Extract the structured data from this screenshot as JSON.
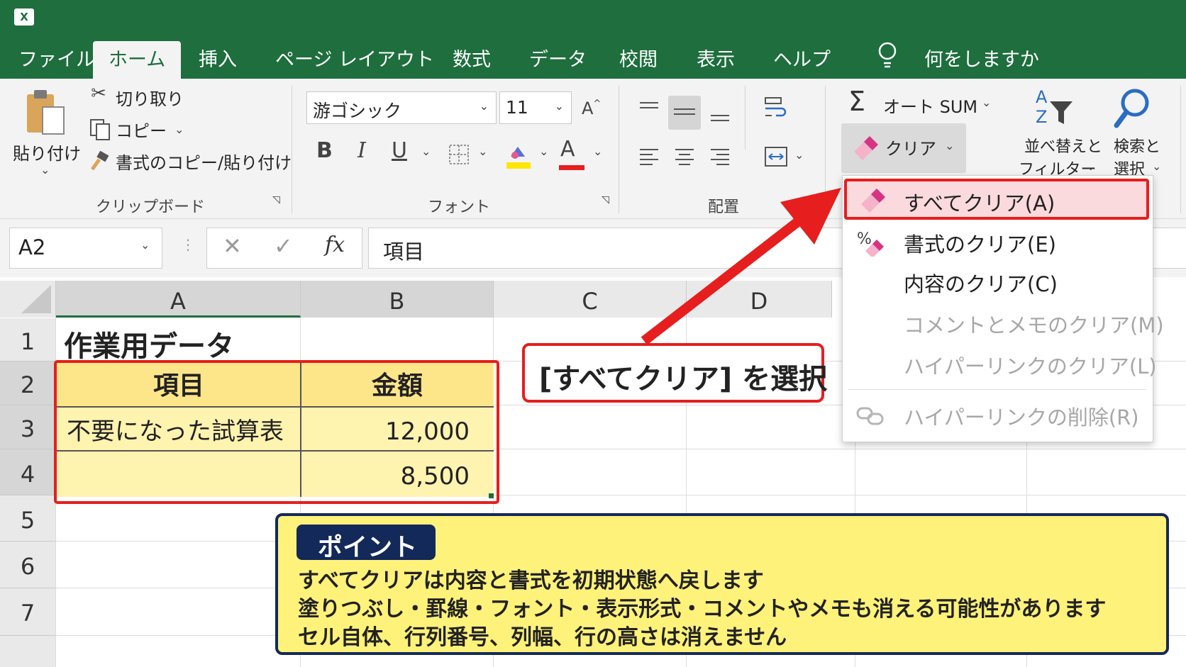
{
  "app": {
    "icon_label": "X"
  },
  "tabs": [
    "ファイル",
    "ホーム",
    "挿入",
    "ページ レイアウト",
    "数式",
    "データ",
    "校閲",
    "表示",
    "ヘルプ"
  ],
  "tell_me": "何をしますか",
  "clipboard": {
    "paste": "貼り付け",
    "cut": "切り取り",
    "copy": "コピー",
    "format_painter": "書式のコピー/貼り付け",
    "label": "クリップボード"
  },
  "font": {
    "name": "游ゴシック",
    "size": "11",
    "label": "フォント",
    "bold": "B",
    "italic": "I",
    "underline": "U",
    "font_color": "A"
  },
  "alignment": {
    "label": "配置"
  },
  "editing": {
    "autosum": "オート SUM",
    "clear": "クリア",
    "sort_filter_line1": "並べ替えと",
    "sort_filter_line2": "フィルター",
    "find_select_line1": "検索と",
    "find_select_line2": "選択"
  },
  "clear_menu": {
    "items": [
      {
        "label": "すべてクリア(A)",
        "enabled": true
      },
      {
        "label": "書式のクリア(E)",
        "enabled": true
      },
      {
        "label": "内容のクリア(C)",
        "enabled": true
      },
      {
        "label": "コメントとメモのクリア(M)",
        "enabled": false
      },
      {
        "label": "ハイパーリンクのクリア(L)",
        "enabled": false
      },
      {
        "label": "ハイパーリンクの削除(R)",
        "enabled": false
      }
    ]
  },
  "formula_bar": {
    "name_box": "A2",
    "fx": "fx",
    "content": "項目"
  },
  "sheet": {
    "columns": [
      "A",
      "B",
      "C",
      "D"
    ],
    "rows": [
      "1",
      "2",
      "3",
      "4",
      "5",
      "6",
      "7"
    ],
    "cells": {
      "A1": "作業用データ",
      "A2": "項目",
      "B2": "金額",
      "A3": "不要になった試算表",
      "B3": "12,000",
      "B4": "8,500"
    }
  },
  "callout": "[すべてクリア] を選択",
  "point_box": {
    "title": "ポイント",
    "lines": [
      "すべてクリアは内容と書式を初期状態へ戻します",
      "塗りつぶし・罫線・フォント・表示形式・コメントやメモも消える可能性があります",
      "セル自体、行列番号、列幅、行の高さは消えません"
    ]
  },
  "colors": {
    "excel_green": "#1e6e3e",
    "highlight_red": "#e61e1e",
    "table_fill": "#fff3b0",
    "table_header_fill": "#fde68a",
    "point_fill": "#fff27a",
    "point_title_bg": "#13295a"
  }
}
